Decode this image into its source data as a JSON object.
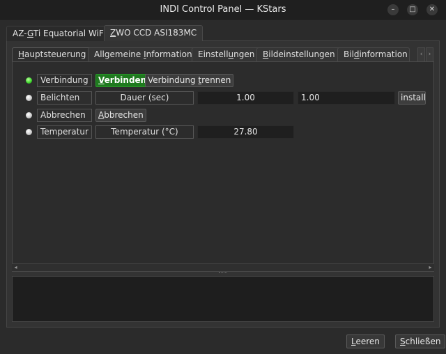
{
  "window": {
    "title": "INDI Control Panel — KStars",
    "controls": {
      "minimize": "–",
      "maximize": "□",
      "close": "✕"
    }
  },
  "device_tabs": [
    {
      "label_pre": "AZ-",
      "label_u": "G",
      "label_post": "Ti Equatorial WiFi",
      "active": false
    },
    {
      "label_pre": "",
      "label_u": "Z",
      "label_post": "WO CCD ASI183MC",
      "active": true
    }
  ],
  "group_tabs": [
    {
      "label_pre": "",
      "label_u": "H",
      "label_post": "auptsteuerung",
      "active": true
    },
    {
      "label_pre": "Allgemeine ",
      "label_u": "I",
      "label_post": "nformation",
      "active": false
    },
    {
      "label_pre": "Einstell",
      "label_u": "u",
      "label_post": "ngen",
      "active": false
    },
    {
      "label_pre": "",
      "label_u": "B",
      "label_post": "ildeinstellungen",
      "active": false
    },
    {
      "label_pre": "Bil",
      "label_u": "d",
      "label_post": "information",
      "active": false
    }
  ],
  "group_scroll": {
    "left": "‹",
    "right": "›"
  },
  "properties": {
    "connection": {
      "status": "green",
      "label": "Verbindung",
      "connect_pre": "",
      "connect_u": "V",
      "connect_post": "erbinden",
      "disconnect_pre": "Verbindung ",
      "disconnect_u": "t",
      "disconnect_post": "rennen"
    },
    "exposure": {
      "status": "grey",
      "label": "Belichten",
      "element_label": "Dauer (sec)",
      "current_value": "1.00",
      "input_value": "1.00",
      "set_button": "installe"
    },
    "abort": {
      "status": "grey",
      "label": "Abbrechen",
      "button_pre": "",
      "button_u": "A",
      "button_post": "bbrechen"
    },
    "temperature": {
      "status": "grey",
      "label": "Temperatur",
      "element_label": "Temperatur (°C)",
      "current_value": "27.80"
    }
  },
  "hscroll": {
    "left": "◂",
    "right": "▸"
  },
  "log": {
    "text": ""
  },
  "bottom_buttons": {
    "clear_pre": "",
    "clear_u": "L",
    "clear_post": "eeren",
    "close_pre": "",
    "close_u": "S",
    "close_post": "chließen"
  }
}
